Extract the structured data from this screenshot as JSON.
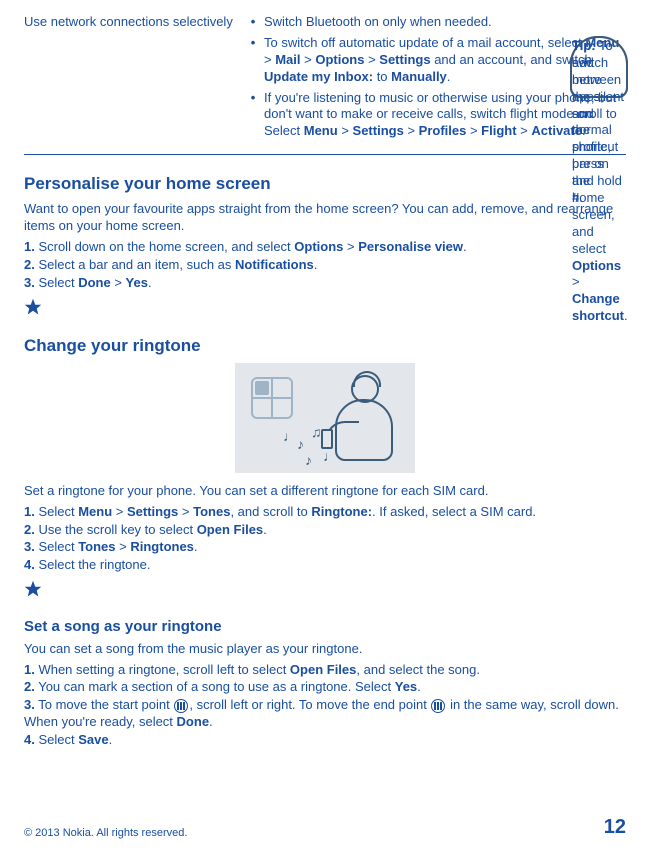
{
  "top": {
    "leftLabel": "Use network connections selectively",
    "bullets": [
      "Switch Bluetooth on only when needed.",
      "To switch off automatic update of a mail account, select <b>Menu</b> > <b>Mail</b> > <b>Options</b> > <b>Settings</b> and an account, and switch <b>Update my Inbox:</b> to <b>Manually</b>.",
      "If you're listening to music or otherwise using your phone, but don't want to make or receive calls, switch flight mode on. Select <b>Menu</b> > <b>Settings</b> > <b>Profiles</b> > <b>Flight</b> > <b>Activate</b>."
    ]
  },
  "s1": {
    "heading": "Personalise your home screen",
    "intro": "Want to open your favourite apps straight from the home screen? You can add, remove, and rearrange items on your home screen.",
    "steps": [
      "Scroll down on the home screen, and select <b>Options</b> > <b>Personalise view</b>.",
      "Select a bar and an item, such as <b>Notifications</b>.",
      "Select <b>Done</b> > <b>Yes</b>."
    ],
    "tipLabel": "Tip:",
    "tipBody": " To add more apps, scroll to the shortcut bar on the home screen, and select <b>Options</b> > <b>Change shortcut</b>."
  },
  "s2": {
    "heading": "Change your ringtone",
    "intro": "Set a ringtone for your phone. You can set a different ringtone for each SIM card.",
    "steps": [
      "Select <b>Menu</b> > <b>Settings</b> > <b>Tones</b>, and scroll to <b>Ringtone:</b>. If asked, select a SIM card.",
      "Use the scroll key to select <b>Open Files</b>.",
      "Select <b>Tones</b> > <b>Ringtones</b>.",
      "Select the ringtone."
    ],
    "tipLabel": "Tip:",
    "tipBody": " To switch between the silent and normal profile, press and hold <b>#</b>."
  },
  "s3": {
    "heading": "Set a song as your ringtone",
    "intro": "You can set a song from the music player as your ringtone.",
    "steps": [
      "When setting a ringtone, scroll left to select <b>Open Files</b>, and select the song.",
      "You can mark a section of a song to use as a ringtone. Select <b>Yes</b>.",
      "To move the start point <span class='mk' data-name='marker-start-icon' data-interactable='false'></span>, scroll left or right. To move the end point <span class='mk' data-name='marker-end-icon' data-interactable='false'></span> in the same way, scroll down. When you're ready, select <b>Done</b>.",
      "Select <b>Save</b>."
    ]
  },
  "footer": {
    "copyright": "© 2013 Nokia. All rights reserved.",
    "page": "12"
  }
}
